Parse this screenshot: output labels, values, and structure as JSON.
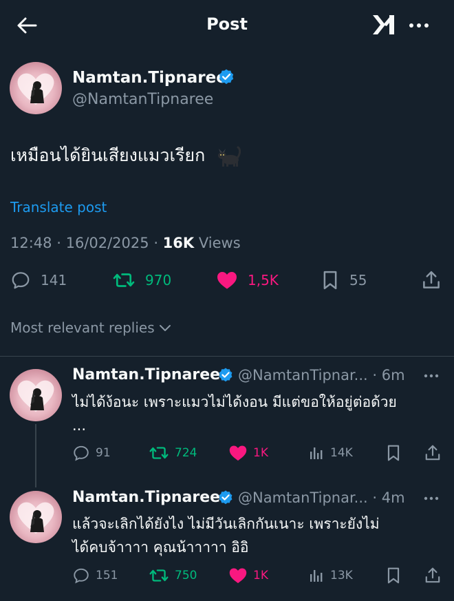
{
  "header": {
    "title": "Post"
  },
  "post": {
    "display_name": "Namtan.Tipnaree",
    "handle": "@NamtanTipnaree",
    "text": "เหมือนได้ยินเสียงแมวเรียก",
    "translate_label": "Translate post",
    "time": "12:48",
    "date": "16/02/2025",
    "views_count": "16K",
    "views_label": "Views",
    "stats": {
      "replies": "141",
      "reposts": "970",
      "likes": "1,5K",
      "bookmarks": "55"
    }
  },
  "sort_label": "Most relevant replies",
  "replies": [
    {
      "display_name": "Namtan.Tipnaree",
      "handle": "@NamtanTipnar...",
      "time": "· 6m",
      "text": "ไม่ได้ง้อนะ เพราะแมวไม่ได้งอน มีแต่ขอให้อยู่ต่อด้วย",
      "text_more": "...",
      "stats": {
        "replies": "91",
        "reposts": "724",
        "likes": "1K",
        "views": "14K"
      }
    },
    {
      "display_name": "Namtan.Tipnaree",
      "handle": "@NamtanTipnar...",
      "time": "· 4m",
      "text": "แล้วจะเลิกได้ยังไง ไม่มีวันเลิกกันเนาะ เพราะยังไม่",
      "text_more": "ได้คบจ้าาาา คุณน้าาาาา อิอิ",
      "stats": {
        "replies": "151",
        "reposts": "750",
        "likes": "1K",
        "views": "13K"
      }
    }
  ],
  "icons": {
    "back": "arrow-left-icon",
    "grok": "grok-icon",
    "more": "more-horizontal-icon",
    "verified": "verified-badge-icon",
    "cat": "black-cat-emoji",
    "reply": "reply-icon",
    "repost": "repost-icon",
    "like": "heart-icon",
    "bookmark": "bookmark-icon",
    "share": "share-icon",
    "views": "views-chart-icon",
    "chevron": "chevron-down-icon"
  },
  "colors": {
    "background": "#15202b",
    "text": "#f7f9f9",
    "muted": "#8b98a5",
    "link": "#1d9bf0",
    "repost": "#00ba7c",
    "like": "#f91880",
    "verified": "#1d9bf0"
  }
}
